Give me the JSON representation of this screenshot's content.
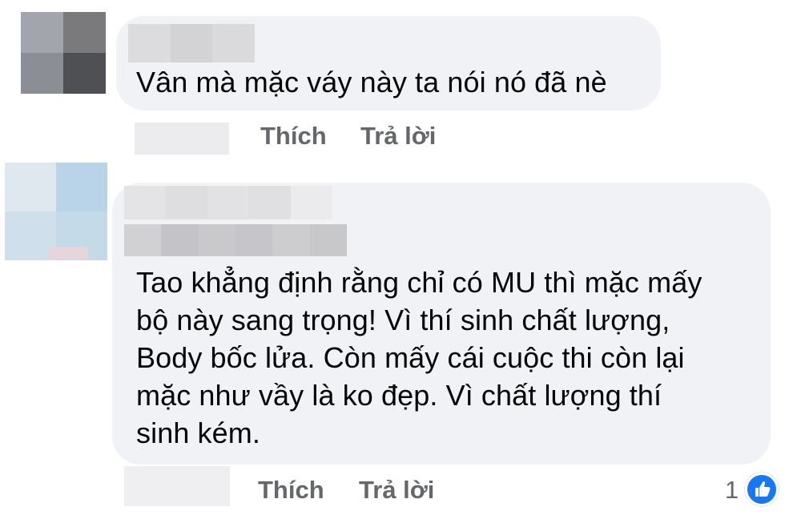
{
  "comments": [
    {
      "text": "Vân mà mặc váy này ta nói nó đã nè",
      "actions": {
        "like": "Thích",
        "reply": "Trả lời"
      }
    },
    {
      "text_lines": [
        "Tao khẳng định rằng chỉ có MU thì mặc mấy",
        "bộ này sang trọng! Vì thí sinh chất lượng,",
        "Body bốc lửa. Còn mấy cái cuộc thi còn lại",
        "mặc như vầy là ko đẹp. Vì chất lượng thí",
        "sinh kém."
      ],
      "actions": {
        "like": "Thích",
        "reply": "Trả lời"
      },
      "reactions": {
        "count": "1",
        "icon": "like-thumb-icon",
        "color": "#1877f2"
      }
    }
  ],
  "colors": {
    "bubble": "#f0f2f5",
    "action_text": "#65676b",
    "text": "#050505"
  }
}
